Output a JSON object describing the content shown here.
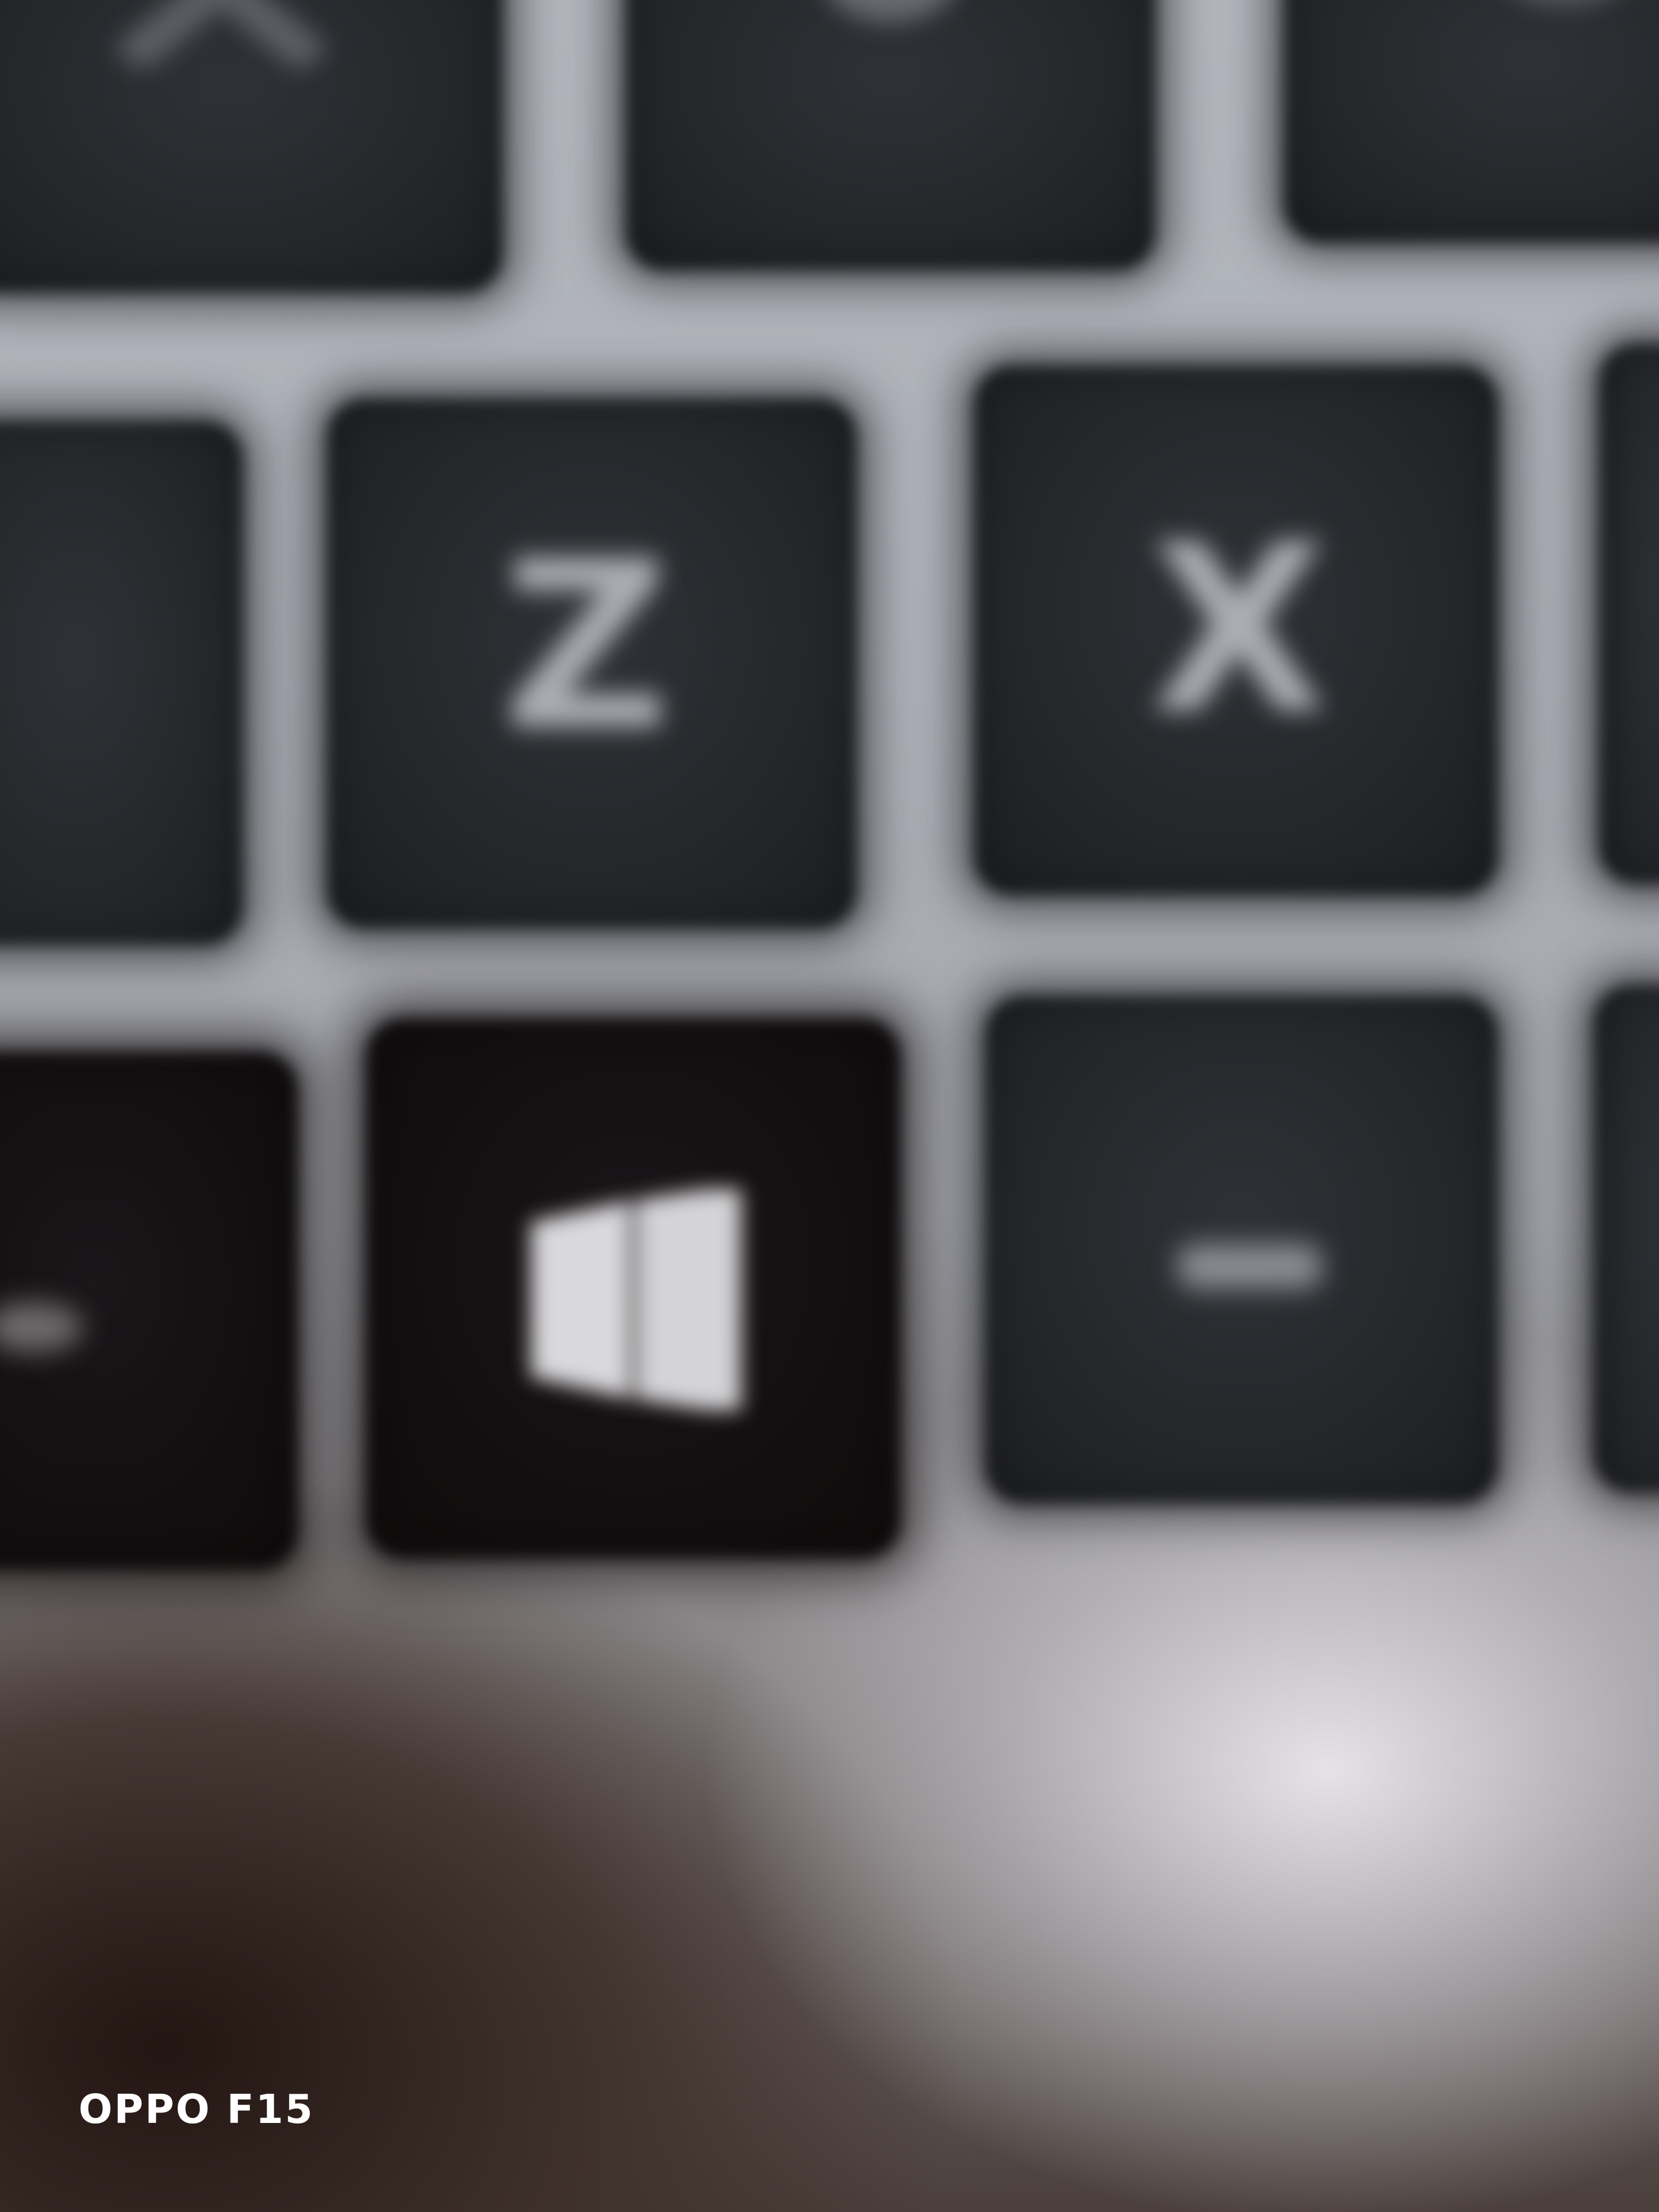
{
  "keyboard": {
    "keys": [
      {
        "name": "key-top-left"
      },
      {
        "name": "key-top-middle"
      },
      {
        "name": "key-top-right"
      },
      {
        "name": "key-left-edge-row2"
      },
      {
        "name": "key-z",
        "legend": "Z"
      },
      {
        "name": "key-x",
        "legend": "X"
      },
      {
        "name": "key-right-edge-row2"
      },
      {
        "name": "key-left-edge-row3"
      },
      {
        "name": "key-windows",
        "icon": "windows-logo-icon"
      },
      {
        "name": "key-alt"
      },
      {
        "name": "key-right-edge-row3"
      }
    ]
  },
  "watermark": {
    "text": "OPPO F15",
    "color": "#ffffff"
  },
  "colors": {
    "key_surface": "#25282b",
    "legend": "#b9bcc1",
    "surround": "#adb0b8"
  }
}
